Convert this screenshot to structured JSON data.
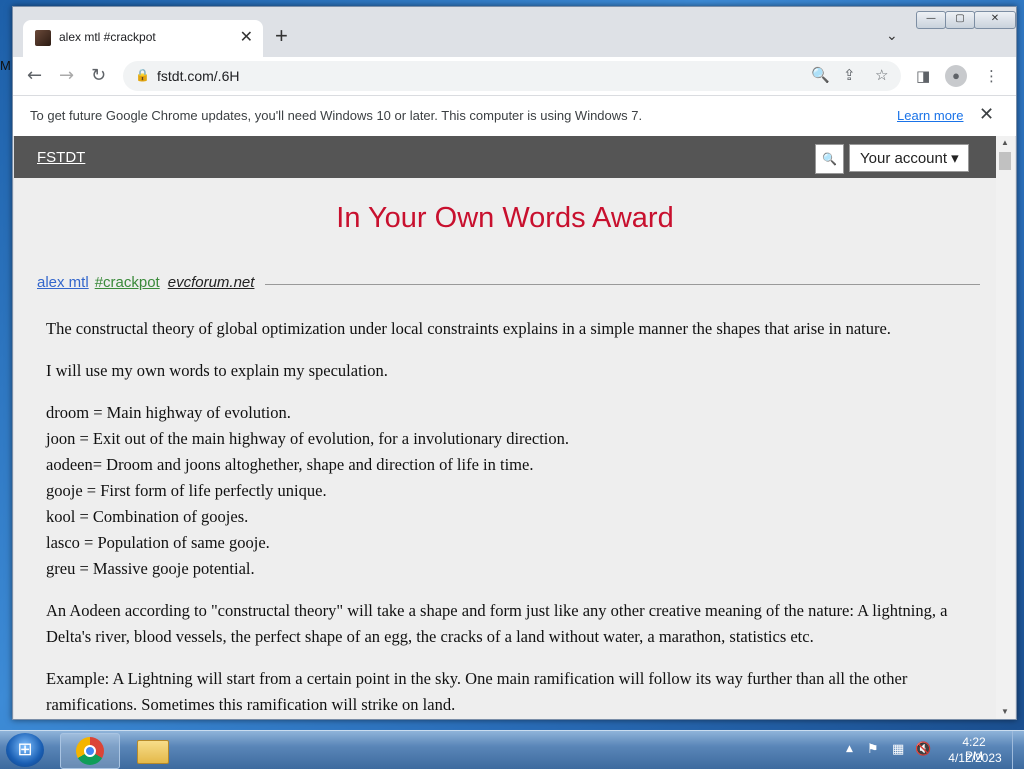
{
  "desktop": {
    "edge_text": "M"
  },
  "browser": {
    "tab": {
      "title": "alex mtl #crackpot",
      "close": "✕"
    },
    "new_tab": "+",
    "tab_search": "⌄",
    "window_controls": {
      "minimize": "—",
      "maximize": "▢",
      "close": "✕"
    },
    "toolbar": {
      "back": "←",
      "forward": "→",
      "reload": "↻",
      "url": "fstdt.com/.6H",
      "icons": [
        "search-icon",
        "share-icon",
        "star-icon",
        "side-panel-icon",
        "profile-icon",
        "menu-icon"
      ]
    },
    "infobar": {
      "message": "To get future Google Chrome updates, you'll need Windows 10 or later. This computer is using Windows 7.",
      "link": "Learn more",
      "close": "✕"
    }
  },
  "site": {
    "logo": "FSTDT",
    "account_label": "Your account ▾",
    "award_title": "In Your Own Words Award",
    "meta": {
      "author": "alex mtl",
      "tag": "#crackpot",
      "source": "evcforum.net"
    },
    "post": {
      "p1": "The constructal theory of global optimization under local constraints explains in a simple manner the shapes that arise in nature.",
      "p2": "I will use my own words to explain my speculation.",
      "definitions": [
        "droom = Main highway of evolution.",
        "joon = Exit out of the main highway of evolution, for a involutionary direction.",
        "aodeen= Droom and joons altoghether, shape and direction of life in time.",
        "gooje = First form of life perfectly unique.",
        "kool = Combination of goojes.",
        "lasco = Population of same gooje.",
        "greu = Massive gooje potential."
      ],
      "p3": "An Aodeen according to \"constructal theory\" will take a shape and form just like any other creative meaning of the nature: A lightning, a Delta's river, blood vessels, the perfect shape of an egg, the cracks of a land without water, a marathon, statistics etc.",
      "p4": "Example: A Lightning will start from a certain point in the sky. One main ramification will follow its way further than all the other ramifications. Sometimes this ramification will strike on land."
    }
  },
  "taskbar": {
    "clock_time": "4:22 PM",
    "clock_date": "4/12/2023",
    "tray": {
      "arrow": "▲",
      "flag": "⚑",
      "network": "▦",
      "volume": "🔇"
    }
  }
}
